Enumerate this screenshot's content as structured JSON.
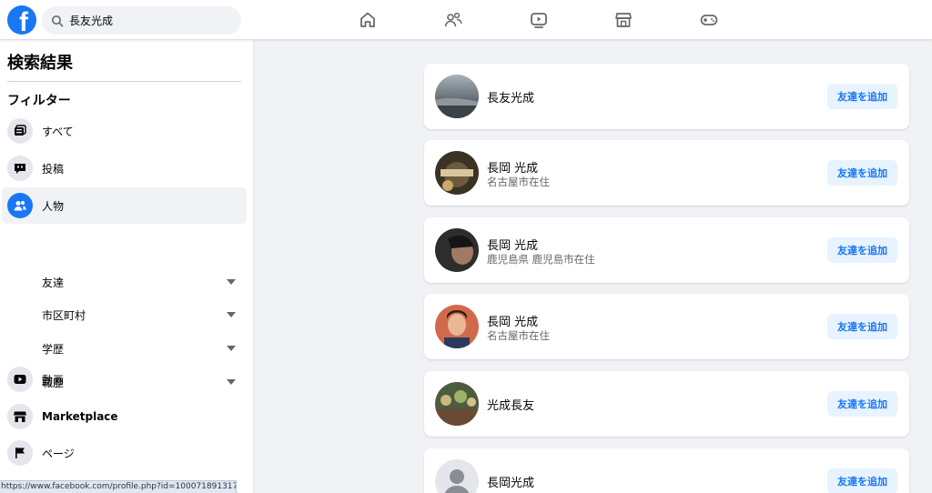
{
  "header": {
    "logo_letter": "f",
    "search": {
      "value": "長友光成"
    },
    "nav_icons": [
      "home-icon",
      "friends-icon",
      "watch-icon",
      "marketplace-icon",
      "gaming-icon"
    ]
  },
  "sidebar": {
    "title": "検索結果",
    "filter_heading": "フィルター",
    "items": [
      {
        "label": "すべて"
      },
      {
        "label": "投稿"
      },
      {
        "label": "人物"
      },
      {
        "label": "動画"
      },
      {
        "label": "Marketplace"
      },
      {
        "label": "ページ"
      }
    ],
    "people_subfilters": [
      {
        "label": "友達"
      },
      {
        "label": "市区町村"
      },
      {
        "label": "学歴"
      },
      {
        "label": "職歴"
      }
    ]
  },
  "results": [
    {
      "name": "長友光成",
      "subtitle": "",
      "button": "友達を追加"
    },
    {
      "name": "長岡 光成",
      "subtitle": "名古屋市在住",
      "button": "友達を追加"
    },
    {
      "name": "長岡 光成",
      "subtitle": "鹿児島県 鹿児島市在住",
      "button": "友達を追加"
    },
    {
      "name": "長岡 光成",
      "subtitle": "名古屋市在住",
      "button": "友達を追加"
    },
    {
      "name": "光成長友",
      "subtitle": "",
      "button": "友達を追加"
    },
    {
      "name": "長岡光成",
      "subtitle": "",
      "button": "友達を追加"
    }
  ],
  "status_bar": {
    "url": "https://www.facebook.com/profile.php?id=100071891317377"
  },
  "colors": {
    "brand": "#1877f2",
    "page_bg": "#f0f2f5",
    "button_bg": "#e7f3ff"
  }
}
